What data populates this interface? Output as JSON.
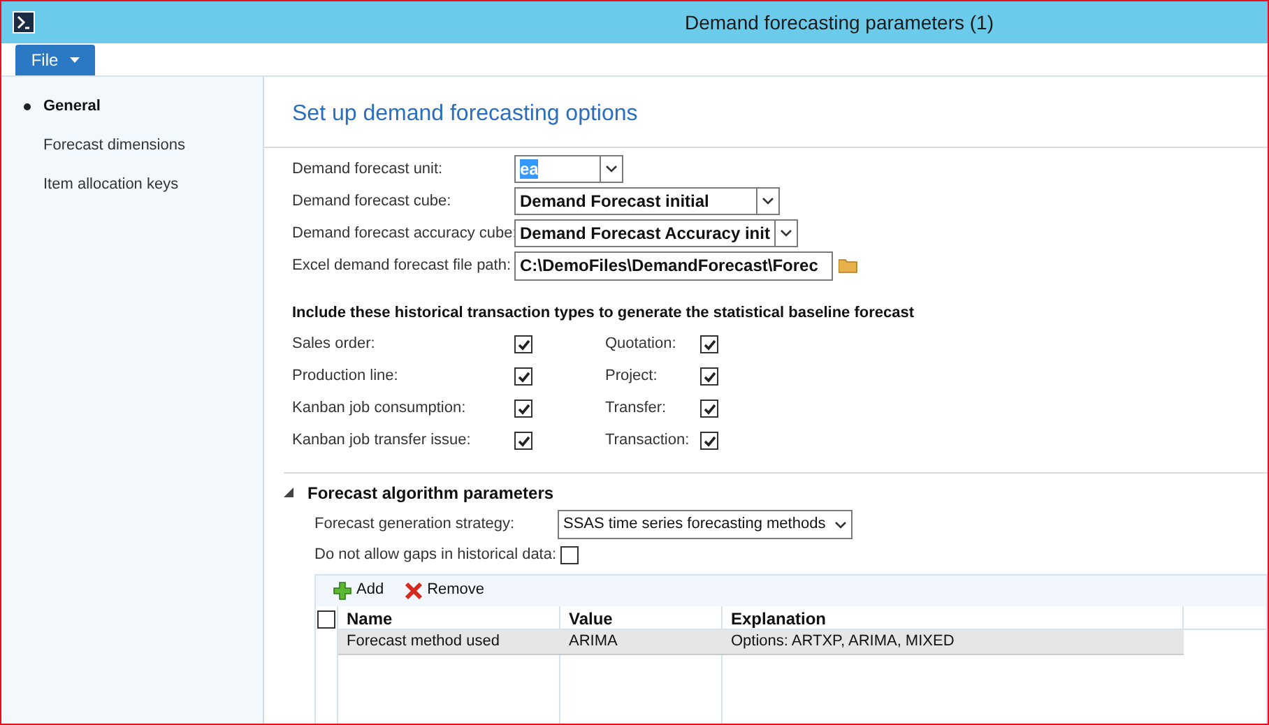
{
  "window": {
    "title": "Demand forecasting parameters (1)"
  },
  "menu": {
    "file": "File"
  },
  "sidebar": {
    "items": [
      {
        "label": "General",
        "selected": true
      },
      {
        "label": "Forecast dimensions",
        "selected": false
      },
      {
        "label": "Item allocation keys",
        "selected": false
      }
    ]
  },
  "heading": "Set up demand forecasting options",
  "fields": [
    {
      "label": "Demand forecast unit:",
      "kind": "combo",
      "value": "ea",
      "highlighted": true
    },
    {
      "label": "Demand forecast cube:",
      "kind": "combo",
      "value": "Demand Forecast initial",
      "highlighted": false
    },
    {
      "label": "Demand forecast accuracy cube:",
      "kind": "combo",
      "value": "Demand Forecast Accuracy init",
      "highlighted": false
    },
    {
      "label": "Excel demand forecast file path:",
      "kind": "path",
      "value": "C:\\DemoFiles\\DemandForecast\\Forec",
      "highlighted": false
    }
  ],
  "transactions": {
    "title": "Include these historical transaction types to generate the statistical baseline forecast",
    "left": [
      {
        "label": "Sales order:",
        "checked": true
      },
      {
        "label": "Production line:",
        "checked": true
      },
      {
        "label": "Kanban job consumption:",
        "checked": true
      },
      {
        "label": "Kanban job transfer issue:",
        "checked": true
      }
    ],
    "right": [
      {
        "label": "Quotation:",
        "checked": true
      },
      {
        "label": "Project:",
        "checked": true
      },
      {
        "label": "Transfer:",
        "checked": true
      },
      {
        "label": "Transaction:",
        "checked": true
      }
    ]
  },
  "algorithm": {
    "title": "Forecast algorithm parameters",
    "expanded": true,
    "strategy": {
      "label": "Forecast generation strategy:",
      "value": "SSAS time series forecasting methods"
    },
    "no_gaps": {
      "label": "Do not allow gaps in historical data:",
      "checked": false
    },
    "toolbar": [
      "Add",
      "Remove"
    ],
    "table": {
      "select_all": false,
      "columns": [
        "Name",
        "Value",
        "Explanation"
      ],
      "rows": [
        {
          "cells": [
            "Forecast method used",
            "ARIMA",
            "Options: ARTXP, ARIMA, MIXED"
          ],
          "selected": true
        }
      ]
    }
  }
}
